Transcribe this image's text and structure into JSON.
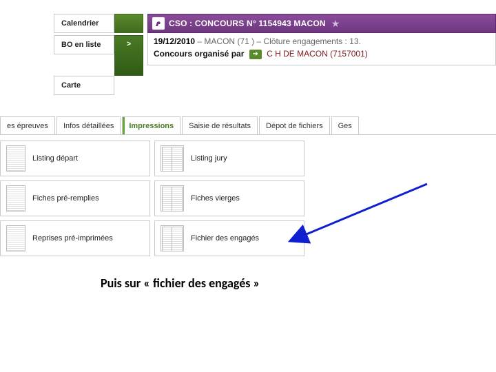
{
  "leftnav": {
    "calendrier": "Calendrier",
    "bo": "BO en liste",
    "carte": "Carte",
    "chev": ">"
  },
  "header": {
    "title": "CSO : CONCOURS N° 1154943 MACON",
    "date": "19/12/2010",
    "sep1": " – ",
    "loc": "MACON (71 )",
    "sep2": " – ",
    "cloture": "Clôture engagements : 13.",
    "org_lbl": "Concours organisé par",
    "org_link": "C H DE MACON (7157001)"
  },
  "tabs": {
    "t0": "es épreuves",
    "t1": "Infos détaillées",
    "t2": "Impressions",
    "t3": "Saisie de résultats",
    "t4": "Dépot de fichiers",
    "t5": "Ges"
  },
  "grid": {
    "r0c0": "Listing départ",
    "r0c1": "Listing jury",
    "r1c0": "Fiches pré-remplies",
    "r1c1": "Fiches vierges",
    "r2c0": "Reprises pré-imprimées",
    "r2c1": "Fichier des engagés"
  },
  "caption": "Puis sur « fichier des engagés »"
}
